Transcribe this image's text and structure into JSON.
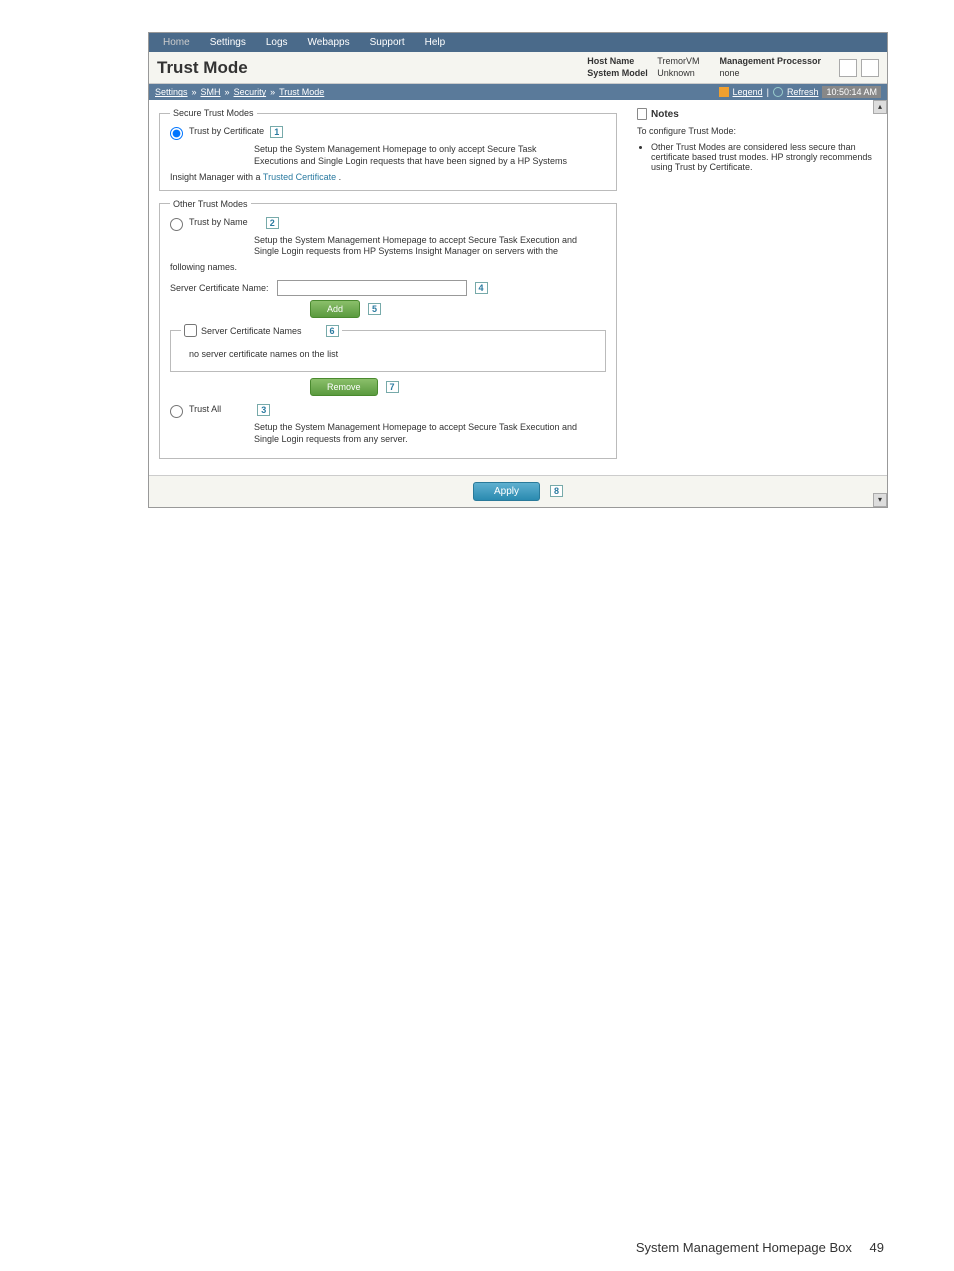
{
  "nav": {
    "items": [
      "Home",
      "Settings",
      "Logs",
      "Webapps",
      "Support",
      "Help"
    ]
  },
  "header": {
    "page_title": "Trust Mode",
    "host_name_label": "Host Name",
    "host_name_value": "TremorVM",
    "system_model_label": "System Model",
    "system_model_value": "Unknown",
    "mgmt_proc_label": "Management Processor",
    "mgmt_proc_value": "none"
  },
  "breadcrumb": {
    "items": [
      "Settings",
      "SMH",
      "Security",
      "Trust Mode"
    ],
    "legend_label": "Legend",
    "refresh_label": "Refresh",
    "time": "10:50:14 AM"
  },
  "secure": {
    "legend": "Secure Trust Modes",
    "trust_by_cert_label": "Trust by Certificate",
    "callout_1": "1",
    "desc_line1": "Setup the System Management Homepage to only accept Secure Task",
    "desc_line2": "Executions and Single Login requests that have been signed by a HP Systems",
    "insight_line": "Insight Manager with a",
    "trusted_cert_link": "Trusted Certificate",
    "period": "."
  },
  "other": {
    "legend": "Other Trust Modes",
    "trust_by_name_label": "Trust by Name",
    "callout_2": "2",
    "desc_name_line1": "Setup the System Management Homepage to accept Secure Task Execution and",
    "desc_name_line2": "Single Login requests from HP Systems Insight Manager on servers with the",
    "following_names": "following names.",
    "cert_name_label": "Server Certificate Name:",
    "callout_4": "4",
    "add_btn": "Add",
    "callout_5": "5",
    "scn_legend": "Server Certificate Names",
    "callout_6": "6",
    "no_certs": "no server certificate names on the list",
    "remove_btn": "Remove",
    "callout_7": "7",
    "trust_all_label": "Trust All",
    "callout_3": "3",
    "trust_all_desc1": "Setup the System Management Homepage to accept Secure Task Execution and",
    "trust_all_desc2": "Single Login requests from any server."
  },
  "notes": {
    "heading": "Notes",
    "intro": "To configure Trust Mode:",
    "bullet": "Other Trust Modes are considered less secure than certificate based trust modes. HP strongly recommends using Trust by Certificate."
  },
  "footer": {
    "apply_btn": "Apply",
    "callout_8": "8"
  },
  "page_footer": {
    "section": "System Management Homepage Box",
    "page_num": "49"
  }
}
